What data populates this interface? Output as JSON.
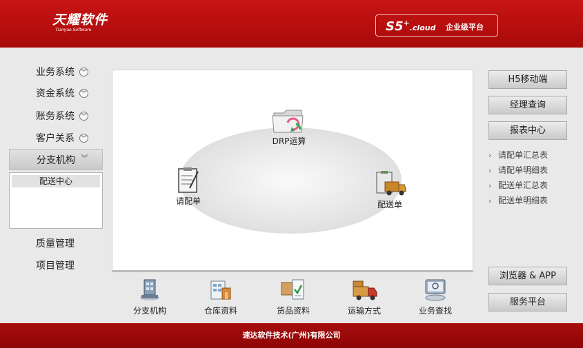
{
  "header": {
    "logo_cn": "天耀软件",
    "logo_en": "Tianyao Software",
    "product": "S5",
    "product_sup": "+",
    "product_suffix": ".cloud",
    "platform": "企业级平台"
  },
  "sidebar": {
    "items": [
      {
        "label": "业务系统",
        "chevron": "»"
      },
      {
        "label": "资金系统",
        "chevron": "»"
      },
      {
        "label": "账务系统",
        "chevron": "»"
      },
      {
        "label": "客户关系",
        "chevron": "»"
      },
      {
        "label": "分支机构",
        "chevron": "»"
      }
    ],
    "submenu": [
      "配送中心"
    ],
    "extra": [
      "质量管理",
      "项目管理"
    ]
  },
  "flow": {
    "nodes": [
      {
        "label": "DRP运算",
        "icon": "folder-sync-icon"
      },
      {
        "label": "请配单",
        "icon": "clipboard-icon"
      },
      {
        "label": "配送单",
        "icon": "delivery-truck-icon"
      }
    ]
  },
  "bottom_icons": [
    {
      "label": "分支机构",
      "icon": "branch-icon"
    },
    {
      "label": "仓库资料",
      "icon": "warehouse-icon"
    },
    {
      "label": "货品资料",
      "icon": "goods-icon"
    },
    {
      "label": "运输方式",
      "icon": "transport-icon"
    },
    {
      "label": "业务查找",
      "icon": "search-icon"
    }
  ],
  "right": {
    "mobile": "H5移动端",
    "manager": "经理查询",
    "report_center": "报表中心",
    "reports": [
      "请配单汇总表",
      "请配单明细表",
      "配送单汇总表",
      "配送单明细表"
    ],
    "browser_app": "浏览器 & APP",
    "service": "服务平台"
  },
  "footer": {
    "company": "速达软件技术(广州)有限公司"
  }
}
